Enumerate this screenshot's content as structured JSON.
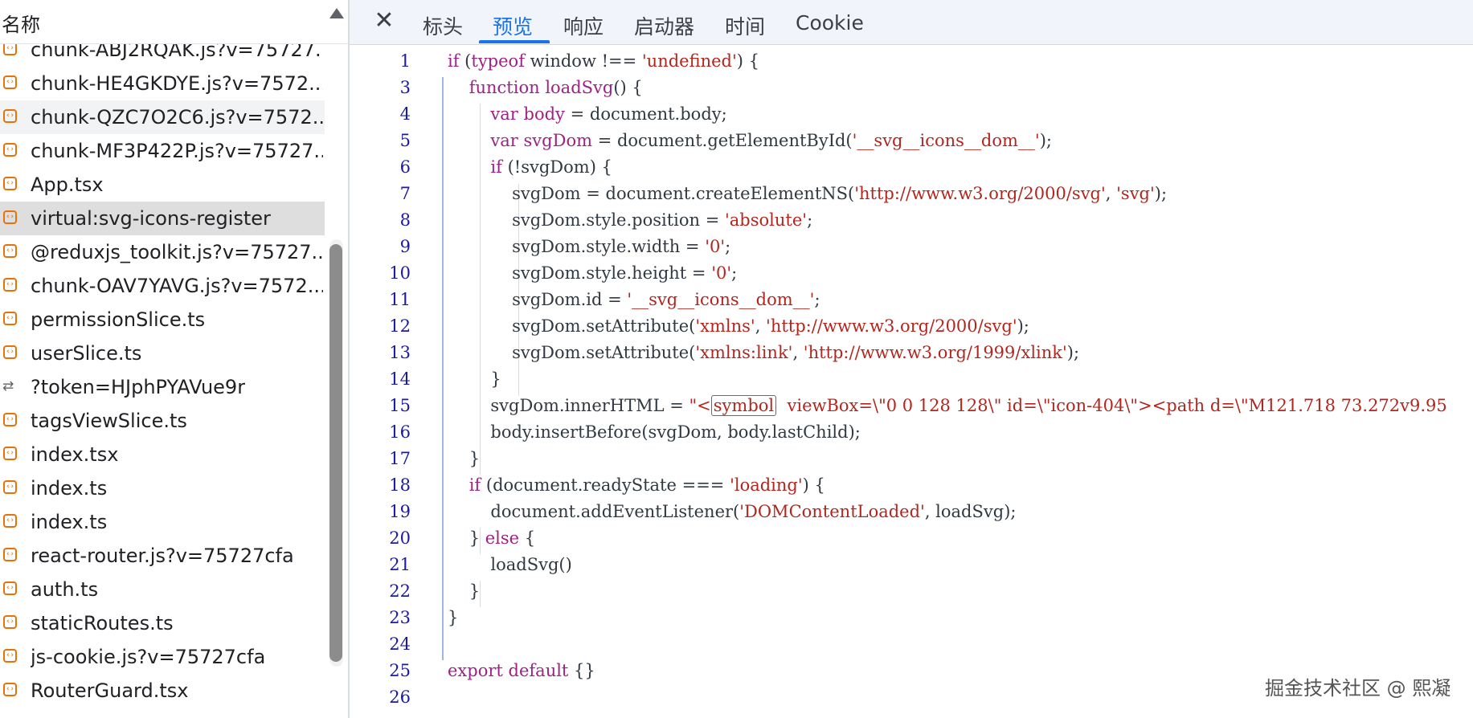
{
  "request_list": {
    "column_header": "名称",
    "items": [
      {
        "name": "chunk-ABJ2RQAK.js?v=75727...",
        "type": "script",
        "state": "normal"
      },
      {
        "name": "chunk-HE4GKDYE.js?v=7572...",
        "type": "script",
        "state": "normal"
      },
      {
        "name": "chunk-QZC7O2C6.js?v=7572...",
        "type": "script",
        "state": "hover"
      },
      {
        "name": "chunk-MF3P422P.js?v=75727...",
        "type": "script",
        "state": "normal"
      },
      {
        "name": "App.tsx",
        "type": "script",
        "state": "normal"
      },
      {
        "name": "virtual:svg-icons-register",
        "type": "script",
        "state": "selected"
      },
      {
        "name": "@reduxjs_toolkit.js?v=75727...",
        "type": "script",
        "state": "normal"
      },
      {
        "name": "chunk-OAV7YAVG.js?v=7572...",
        "type": "script",
        "state": "normal"
      },
      {
        "name": "permissionSlice.ts",
        "type": "script",
        "state": "normal"
      },
      {
        "name": "userSlice.ts",
        "type": "script",
        "state": "normal"
      },
      {
        "name": "?token=HJphPYAVue9r",
        "type": "fetch",
        "state": "normal"
      },
      {
        "name": "tagsViewSlice.ts",
        "type": "script",
        "state": "normal"
      },
      {
        "name": "index.tsx",
        "type": "script",
        "state": "normal"
      },
      {
        "name": "index.ts",
        "type": "script",
        "state": "normal"
      },
      {
        "name": "index.ts",
        "type": "script",
        "state": "normal"
      },
      {
        "name": "react-router.js?v=75727cfa",
        "type": "script",
        "state": "normal"
      },
      {
        "name": "auth.ts",
        "type": "script",
        "state": "normal"
      },
      {
        "name": "staticRoutes.ts",
        "type": "script",
        "state": "normal"
      },
      {
        "name": "js-cookie.js?v=75727cfa",
        "type": "script",
        "state": "normal"
      },
      {
        "name": "RouterGuard.tsx",
        "type": "script",
        "state": "normal"
      }
    ]
  },
  "detail_tabs": {
    "close_icon": "close-icon",
    "tabs": [
      "标头",
      "预览",
      "响应",
      "启动器",
      "时间",
      "Cookie"
    ],
    "active": "预览"
  },
  "code_lines": [
    {
      "num": "1",
      "parts": [
        [
          "kw",
          "if"
        ],
        [
          "t",
          " ("
        ],
        [
          "kw",
          "typeof"
        ],
        [
          "t",
          " window !== "
        ],
        [
          "str",
          "'undefined'"
        ],
        [
          "t",
          ") {"
        ]
      ]
    },
    {
      "num": "3",
      "parts": [
        [
          "t",
          "    "
        ],
        [
          "kw",
          "function"
        ],
        [
          "t",
          " "
        ],
        [
          "kw",
          "loadSvg"
        ],
        [
          "t",
          "() {"
        ]
      ]
    },
    {
      "num": "4",
      "parts": [
        [
          "t",
          "        "
        ],
        [
          "kw",
          "var"
        ],
        [
          "t",
          " "
        ],
        [
          "kw",
          "body"
        ],
        [
          "t",
          " = document.body;"
        ]
      ]
    },
    {
      "num": "5",
      "parts": [
        [
          "t",
          "        "
        ],
        [
          "kw",
          "var"
        ],
        [
          "t",
          " "
        ],
        [
          "kw",
          "svgDom"
        ],
        [
          "t",
          " = document.getElementById("
        ],
        [
          "str",
          "'__svg__icons__dom__'"
        ],
        [
          "t",
          ");"
        ]
      ]
    },
    {
      "num": "6",
      "parts": [
        [
          "t",
          "        "
        ],
        [
          "kw",
          "if"
        ],
        [
          "t",
          " (!svgDom) {"
        ]
      ]
    },
    {
      "num": "7",
      "parts": [
        [
          "t",
          "            svgDom = document.createElementNS("
        ],
        [
          "str",
          "'http://www.w3.org/2000/svg'"
        ],
        [
          "t",
          ", "
        ],
        [
          "str",
          "'svg'"
        ],
        [
          "t",
          ");"
        ]
      ]
    },
    {
      "num": "8",
      "parts": [
        [
          "t",
          "            svgDom.style.position = "
        ],
        [
          "str",
          "'absolute'"
        ],
        [
          "t",
          ";"
        ]
      ]
    },
    {
      "num": "9",
      "parts": [
        [
          "t",
          "            svgDom.style.width = "
        ],
        [
          "str",
          "'0'"
        ],
        [
          "t",
          ";"
        ]
      ]
    },
    {
      "num": "10",
      "parts": [
        [
          "t",
          "            svgDom.style.height = "
        ],
        [
          "str",
          "'0'"
        ],
        [
          "t",
          ";"
        ]
      ]
    },
    {
      "num": "11",
      "parts": [
        [
          "t",
          "            svgDom.id = "
        ],
        [
          "str",
          "'__svg__icons__dom__'"
        ],
        [
          "t",
          ";"
        ]
      ]
    },
    {
      "num": "12",
      "parts": [
        [
          "t",
          "            svgDom.setAttribute("
        ],
        [
          "str",
          "'xmlns'"
        ],
        [
          "t",
          ", "
        ],
        [
          "str",
          "'http://www.w3.org/2000/svg'"
        ],
        [
          "t",
          ");"
        ]
      ]
    },
    {
      "num": "13",
      "parts": [
        [
          "t",
          "            svgDom.setAttribute("
        ],
        [
          "str",
          "'xmlns:link'"
        ],
        [
          "t",
          ", "
        ],
        [
          "str",
          "'http://www.w3.org/1999/xlink'"
        ],
        [
          "t",
          ");"
        ]
      ]
    },
    {
      "num": "14",
      "parts": [
        [
          "t",
          "        }"
        ]
      ]
    },
    {
      "num": "15",
      "parts": [
        [
          "t",
          "        svgDom.innerHTML = "
        ],
        [
          "str",
          "\"<"
        ],
        [
          "box",
          "symbol"
        ],
        [
          "str",
          "  viewBox=\\\"0 0 128 128\\\" id=\\\"icon-404\\\"><path d=\\\"M121.718 73.272v9.95"
        ]
      ]
    },
    {
      "num": "16",
      "parts": [
        [
          "t",
          "        body.insertBefore(svgDom, body.lastChild);"
        ]
      ]
    },
    {
      "num": "17",
      "parts": [
        [
          "t",
          "    }"
        ]
      ]
    },
    {
      "num": "18",
      "parts": [
        [
          "t",
          "    "
        ],
        [
          "kw",
          "if"
        ],
        [
          "t",
          " (document.readyState === "
        ],
        [
          "str",
          "'loading'"
        ],
        [
          "t",
          ") {"
        ]
      ]
    },
    {
      "num": "19",
      "parts": [
        [
          "t",
          "        document.addEventListener("
        ],
        [
          "str",
          "'DOMContentLoaded'"
        ],
        [
          "t",
          ", loadSvg);"
        ]
      ]
    },
    {
      "num": "20",
      "parts": [
        [
          "t",
          "    } "
        ],
        [
          "kw",
          "else"
        ],
        [
          "t",
          " {"
        ]
      ]
    },
    {
      "num": "21",
      "parts": [
        [
          "t",
          "        loadSvg()"
        ]
      ]
    },
    {
      "num": "22",
      "parts": [
        [
          "t",
          "    }"
        ]
      ]
    },
    {
      "num": "23",
      "parts": [
        [
          "t",
          "}"
        ]
      ]
    },
    {
      "num": "24",
      "parts": []
    },
    {
      "num": "25",
      "parts": [
        [
          "kw",
          "export"
        ],
        [
          "t",
          " "
        ],
        [
          "kw",
          "default"
        ],
        [
          "t",
          " {}"
        ]
      ]
    },
    {
      "num": "26",
      "parts": []
    }
  ],
  "watermark": "掘金技术社区 @ 熙凝",
  "colors": {
    "accent": "#1a73e8",
    "keyword": "#9d2284",
    "string": "#b3261e",
    "line_number": "#1a1aa6",
    "script_icon": "#e8710a"
  }
}
